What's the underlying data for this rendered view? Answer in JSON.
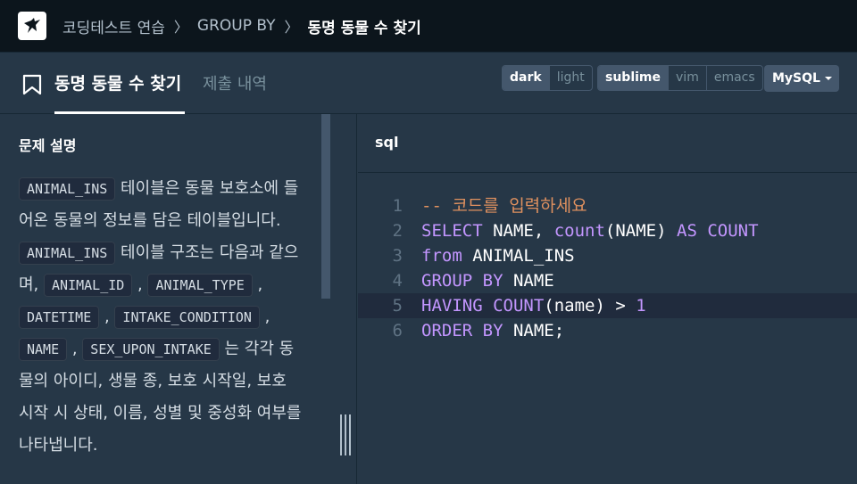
{
  "breadcrumb": {
    "items": [
      "코딩테스트 연습",
      "GROUP BY",
      "동명 동물 수 찾기"
    ]
  },
  "tabs": {
    "active": "동명 동물 수 찾기",
    "other": "제출 내역"
  },
  "theme": {
    "options": [
      "dark",
      "light"
    ],
    "selected": "dark"
  },
  "keymap": {
    "options": [
      "sublime",
      "vim",
      "emacs"
    ],
    "selected": "sublime"
  },
  "language": {
    "selected": "MySQL"
  },
  "problem": {
    "heading": "문제 설명",
    "segments": [
      {
        "t": "code",
        "v": "ANIMAL_INS"
      },
      {
        "t": "text",
        "v": " 테이블은 동물 보호소에 들어온 동물의 정보를 담은 테이블입니다. "
      },
      {
        "t": "code",
        "v": "ANIMAL_INS"
      },
      {
        "t": "text",
        "v": " 테이블 구조는 다음과 같으며, "
      },
      {
        "t": "code",
        "v": "ANIMAL_ID"
      },
      {
        "t": "text",
        "v": " , "
      },
      {
        "t": "code",
        "v": "ANIMAL_TYPE"
      },
      {
        "t": "text",
        "v": " , "
      },
      {
        "t": "code",
        "v": "DATETIME"
      },
      {
        "t": "text",
        "v": " , "
      },
      {
        "t": "code",
        "v": "INTAKE_CONDITION"
      },
      {
        "t": "text",
        "v": " , "
      },
      {
        "t": "code",
        "v": "NAME"
      },
      {
        "t": "text",
        "v": " , "
      },
      {
        "t": "code",
        "v": "SEX_UPON_INTAKE"
      },
      {
        "t": "text",
        "v": " 는 각각 동물의 아이디, 생물 종, 보호 시작일, 보호 시작 시 상태, 이름, 성별 및 중성화 여부를 나타냅니다."
      }
    ]
  },
  "editor": {
    "language_label": "sql",
    "active_line": 5,
    "lines": [
      {
        "n": "1",
        "tokens": [
          {
            "c": "cm",
            "v": "-- 코드를 입력하세요"
          }
        ]
      },
      {
        "n": "2",
        "tokens": [
          {
            "c": "kw",
            "v": "SELECT"
          },
          {
            "c": "",
            "v": " NAME, "
          },
          {
            "c": "fn",
            "v": "count"
          },
          {
            "c": "",
            "v": "(NAME) "
          },
          {
            "c": "kw",
            "v": "AS"
          },
          {
            "c": "",
            "v": " "
          },
          {
            "c": "kw",
            "v": "COUNT"
          }
        ]
      },
      {
        "n": "3",
        "tokens": [
          {
            "c": "kw",
            "v": "from"
          },
          {
            "c": "",
            "v": " ANIMAL_INS"
          }
        ]
      },
      {
        "n": "4",
        "tokens": [
          {
            "c": "kw",
            "v": "GROUP BY"
          },
          {
            "c": "",
            "v": " NAME"
          }
        ]
      },
      {
        "n": "5",
        "tokens": [
          {
            "c": "kw",
            "v": "HAVING COUNT"
          },
          {
            "c": "",
            "v": "(name) > "
          },
          {
            "c": "num",
            "v": "1"
          }
        ]
      },
      {
        "n": "6",
        "tokens": [
          {
            "c": "kw",
            "v": "ORDER BY"
          },
          {
            "c": "",
            "v": " NAME;"
          }
        ]
      }
    ]
  }
}
